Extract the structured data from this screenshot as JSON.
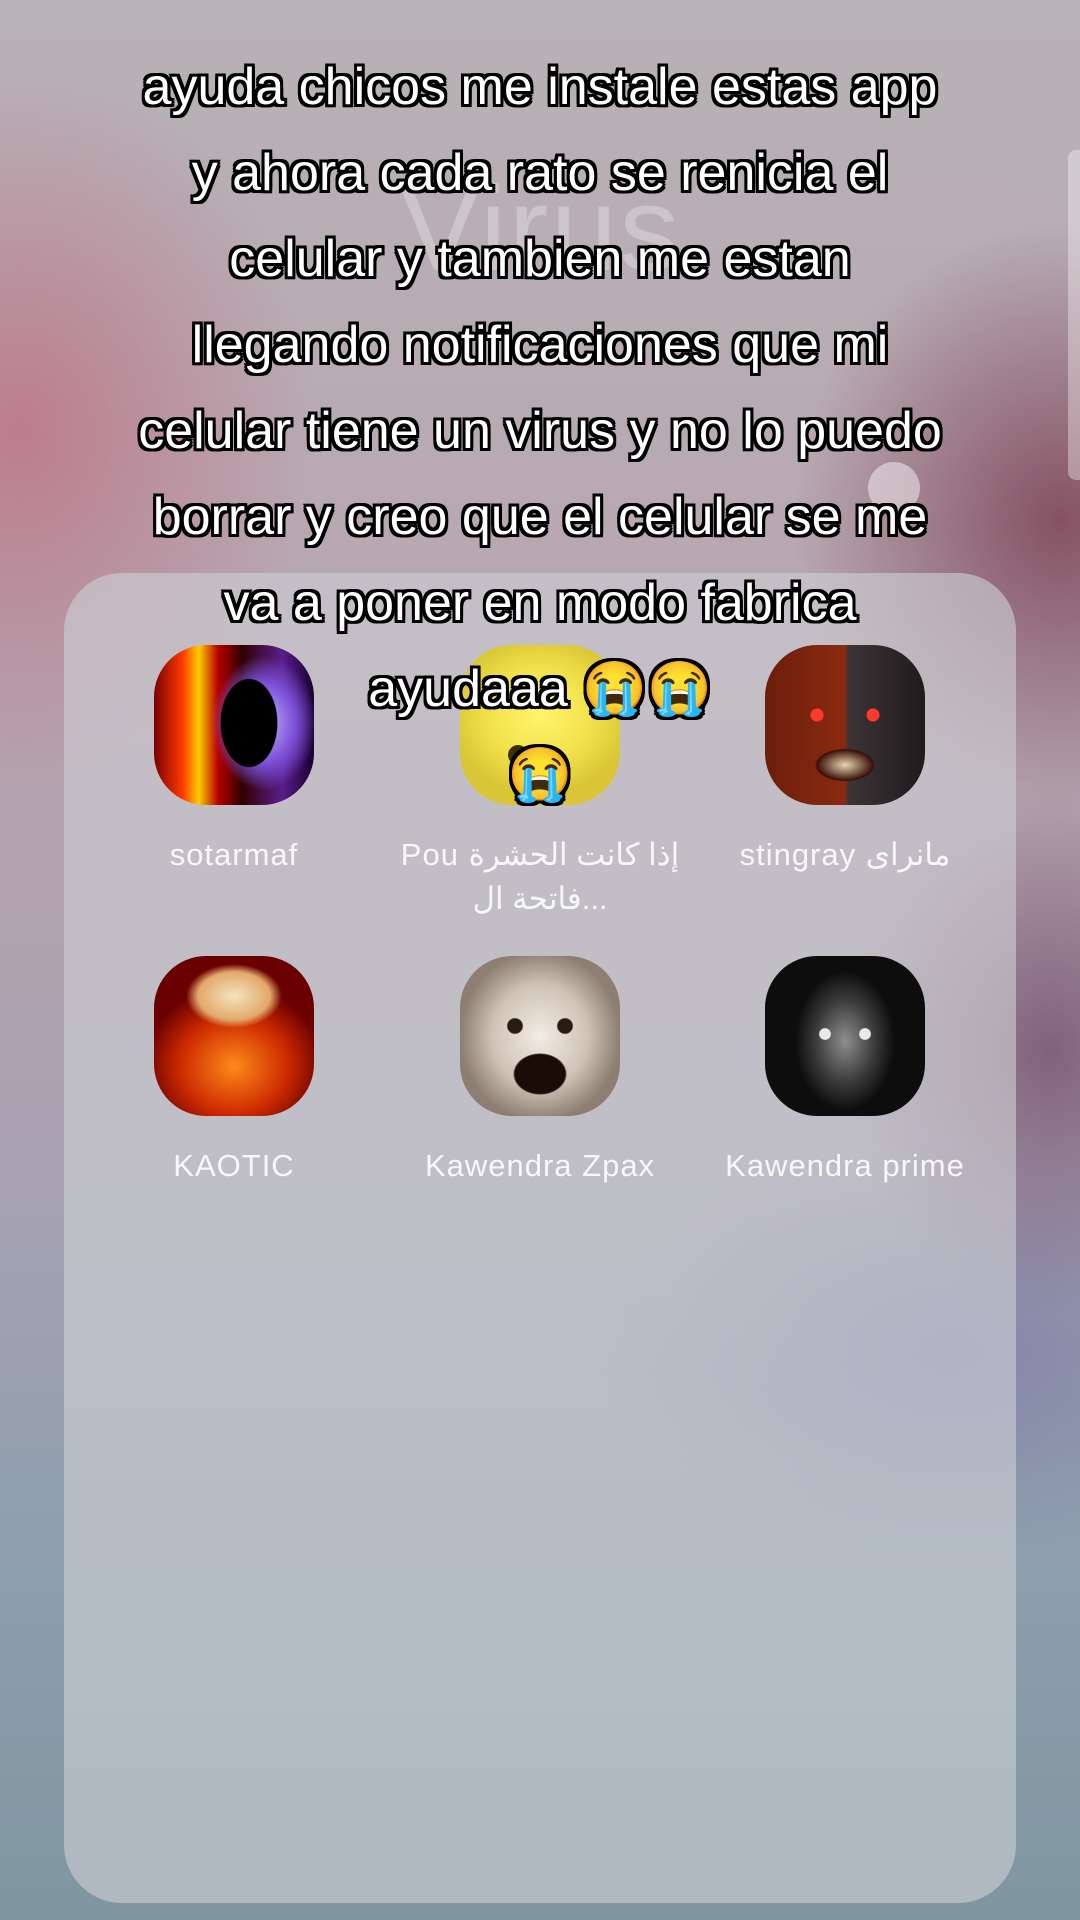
{
  "background_text": "Virus",
  "caption": "ayuda chicos me instale estas app\ny ahora cada rato se renicia el\ncelular y tambien me estan\nllegando notificaciones que mi\ncelular tiene un virus y no lo puedo\nborrar y creo que el celular se me\nva a poner en modo fabrica\nayudaaa 😭😭\n😭",
  "folder": {
    "apps": [
      {
        "label": "sotarmaf",
        "icon": "red-purple-eye-icon"
      },
      {
        "label": "Pou إذا كانت الحشرة فاتحة ال...",
        "icon": "pou-icon"
      },
      {
        "label": "stingray مانرای",
        "icon": "freddy-animatronic-icon"
      },
      {
        "label": "KAOTIC",
        "icon": "explosion-icon"
      },
      {
        "label": "Kawendra Zpax",
        "icon": "clown-face-icon"
      },
      {
        "label": "Kawendra prime",
        "icon": "dark-monster-icon"
      }
    ]
  },
  "colors": {
    "caption_text": "#ffffff",
    "caption_outline": "#000000",
    "label_text": "#ffffff"
  }
}
